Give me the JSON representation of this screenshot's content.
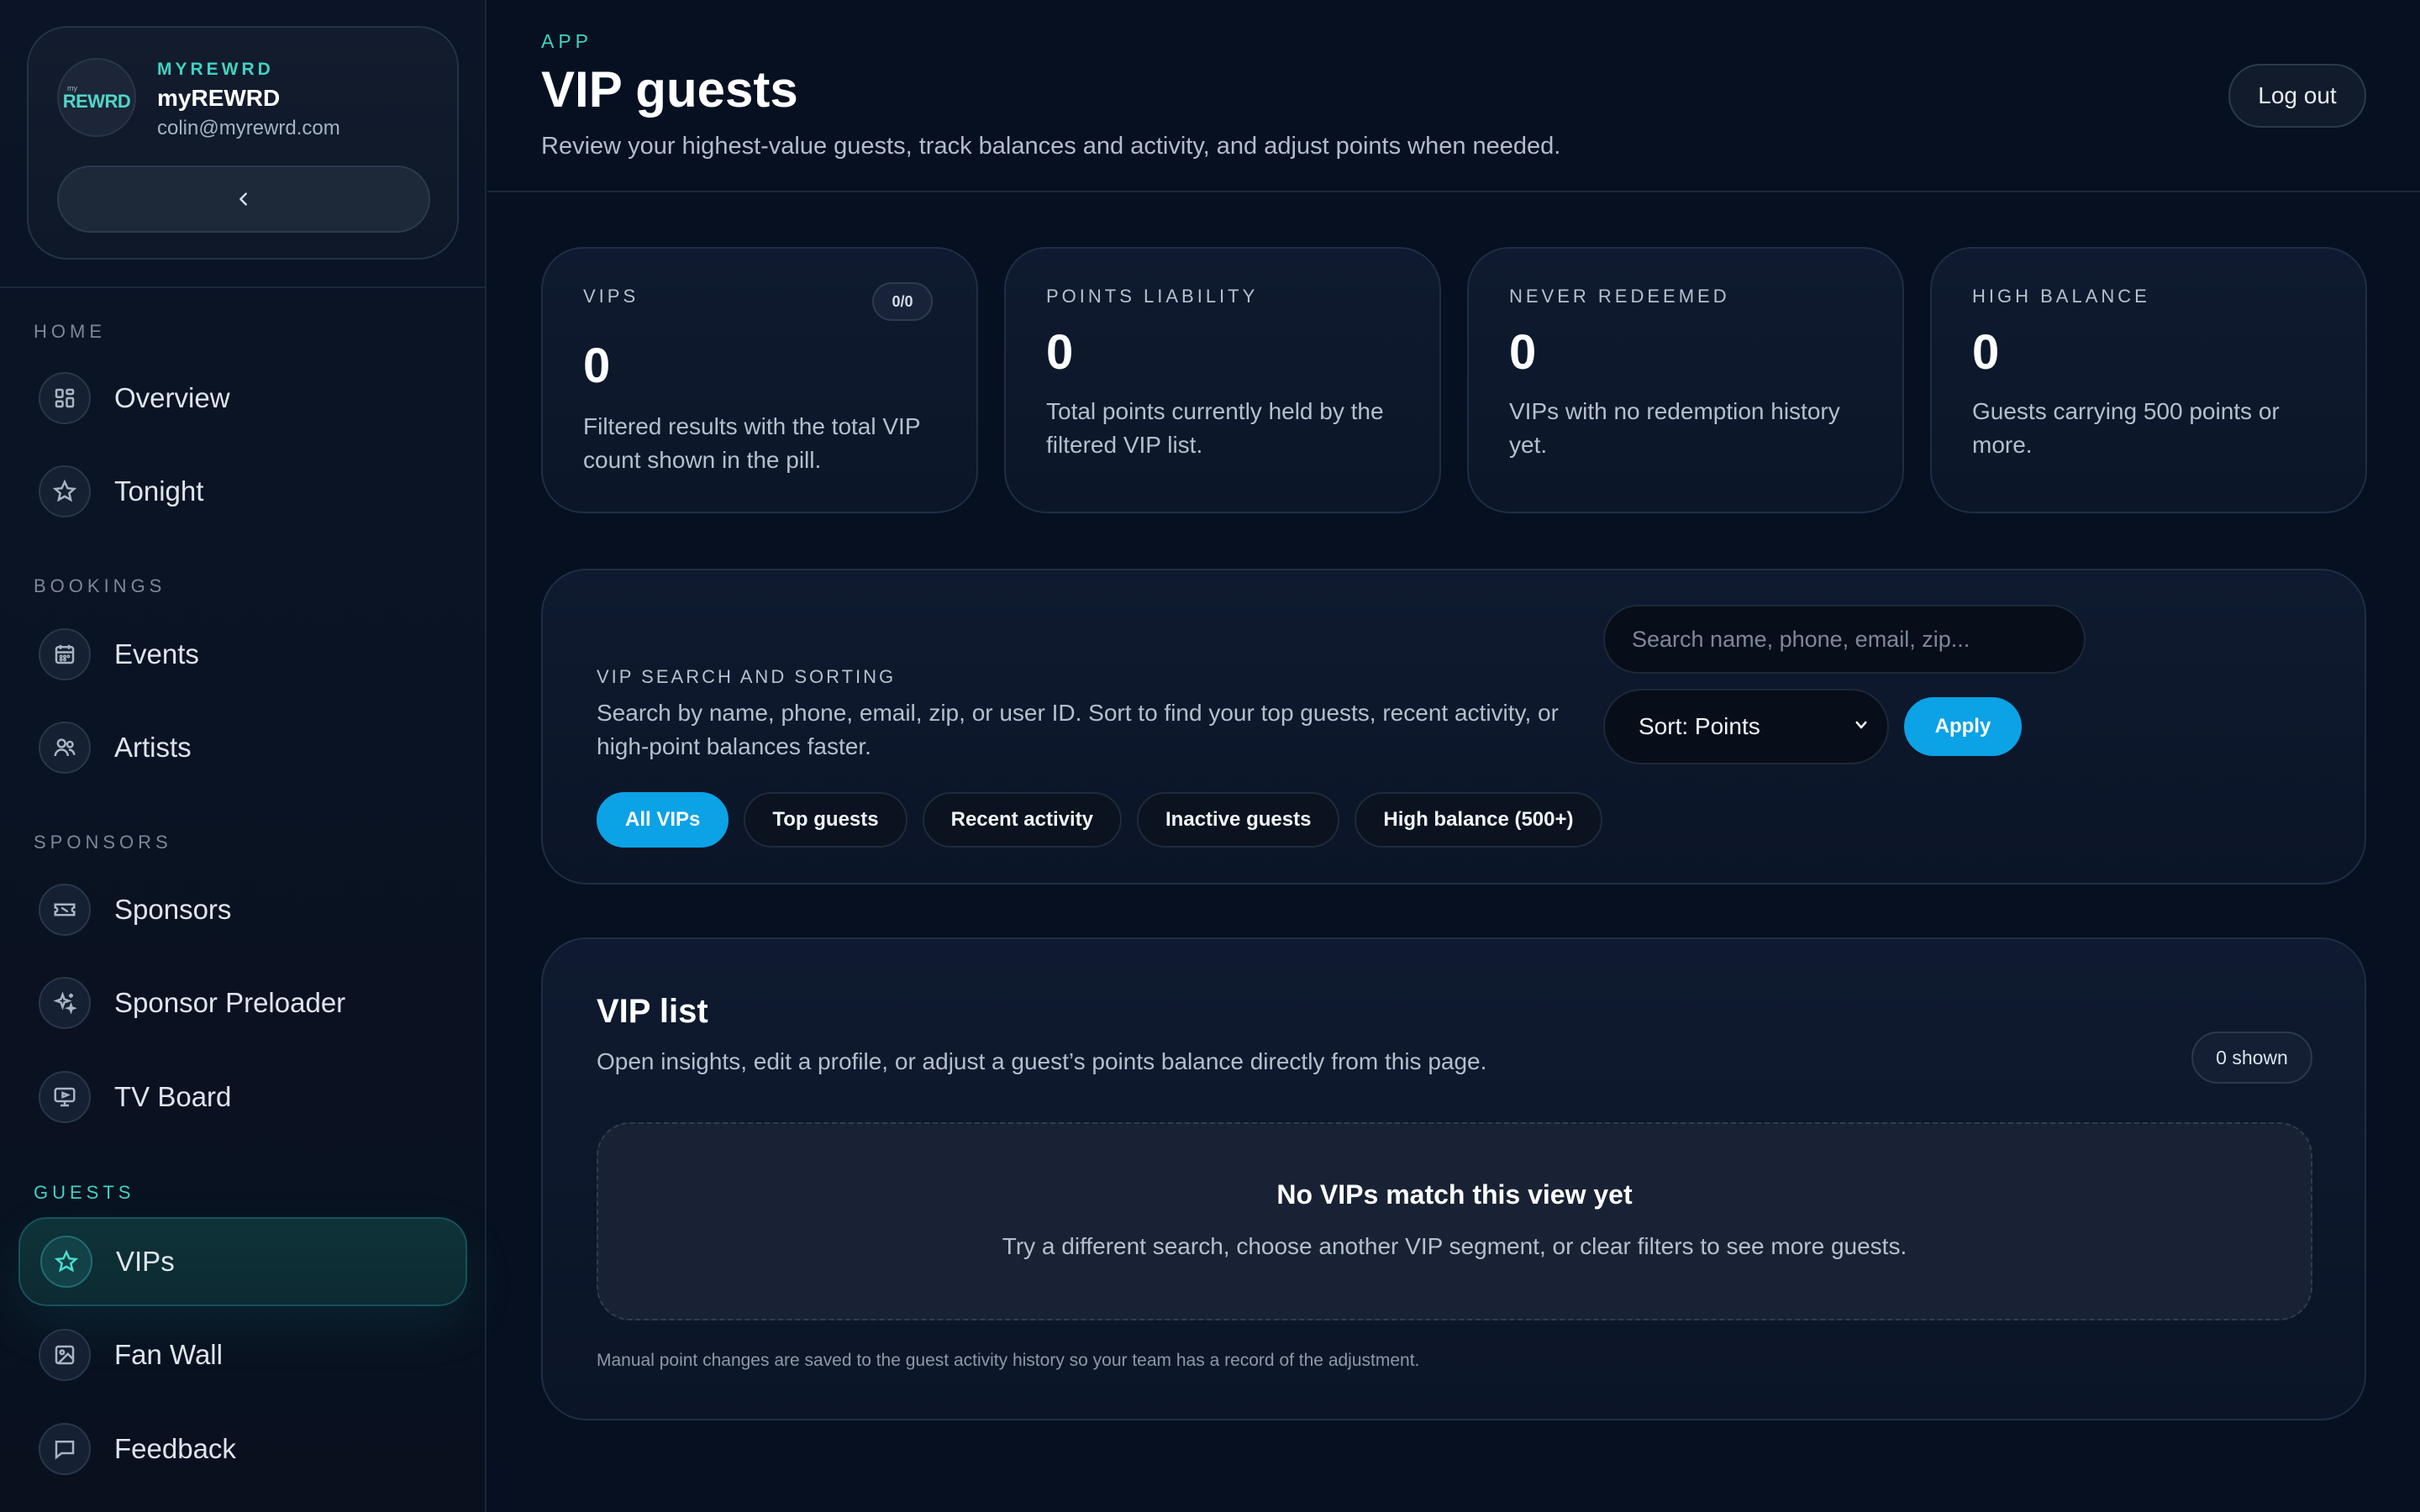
{
  "sidebar": {
    "brand": {
      "logo_small": "my",
      "logo_main": "REWRD",
      "kicker": "MYREWRD",
      "name": "myREWRD",
      "email": "colin@myrewrd.com"
    },
    "collapse_label": "‹",
    "sections": [
      {
        "title": "HOME",
        "items": [
          {
            "label": "Overview",
            "icon": "grid-icon"
          },
          {
            "label": "Tonight",
            "icon": "star-icon"
          }
        ]
      },
      {
        "title": "BOOKINGS",
        "items": [
          {
            "label": "Events",
            "icon": "calendar-icon"
          },
          {
            "label": "Artists",
            "icon": "users-icon"
          }
        ]
      },
      {
        "title": "SPONSORS",
        "items": [
          {
            "label": "Sponsors",
            "icon": "ticket-icon"
          },
          {
            "label": "Sponsor Preloader",
            "icon": "sparkles-icon"
          },
          {
            "label": "TV Board",
            "icon": "tv-icon"
          }
        ]
      },
      {
        "title": "GUESTS",
        "items": [
          {
            "label": "VIPs",
            "icon": "star-icon",
            "active": true
          },
          {
            "label": "Fan Wall",
            "icon": "image-icon"
          },
          {
            "label": "Feedback",
            "icon": "message-icon"
          }
        ]
      }
    ]
  },
  "header": {
    "kicker": "APP",
    "title": "VIP guests",
    "subtitle": "Review your highest-value guests, track balances and activity, and adjust points when needed.",
    "logout_label": "Log out"
  },
  "stats": [
    {
      "label": "VIPS",
      "value": "0",
      "pill": "0/0",
      "desc": "Filtered results with the total VIP count shown in the pill."
    },
    {
      "label": "POINTS LIABILITY",
      "value": "0",
      "desc": "Total points currently held by the filtered VIP list."
    },
    {
      "label": "NEVER REDEEMED",
      "value": "0",
      "desc": "VIPs with no redemption history yet."
    },
    {
      "label": "HIGH BALANCE",
      "value": "0",
      "desc": "Guests carrying 500 points or more."
    }
  ],
  "search": {
    "kicker": "VIP SEARCH AND SORTING",
    "desc": "Search by name, phone, email, zip, or user ID. Sort to find your top guests, recent activity, or high-point balances faster.",
    "placeholder": "Search name, phone, email, zip...",
    "value": "",
    "sort_label": "Sort: Points",
    "apply_label": "Apply",
    "chips": [
      "All VIPs",
      "Top guests",
      "Recent activity",
      "Inactive guests",
      "High balance (500+)"
    ],
    "active_chip": "All VIPs"
  },
  "list": {
    "title": "VIP list",
    "subtitle": "Open insights, edit a profile, or adjust a guest’s points balance directly from this page.",
    "shown_label": "0 shown",
    "empty_title": "No VIPs match this view yet",
    "empty_sub": "Try a different search, choose another VIP segment, or clear filters to see more guests.",
    "note": "Manual point changes are saved to the guest activity history so your team has a record of the adjustment."
  },
  "colors": {
    "accent_teal": "#3fd3c0",
    "accent_blue": "#0ba2e6",
    "background": "#071021"
  }
}
